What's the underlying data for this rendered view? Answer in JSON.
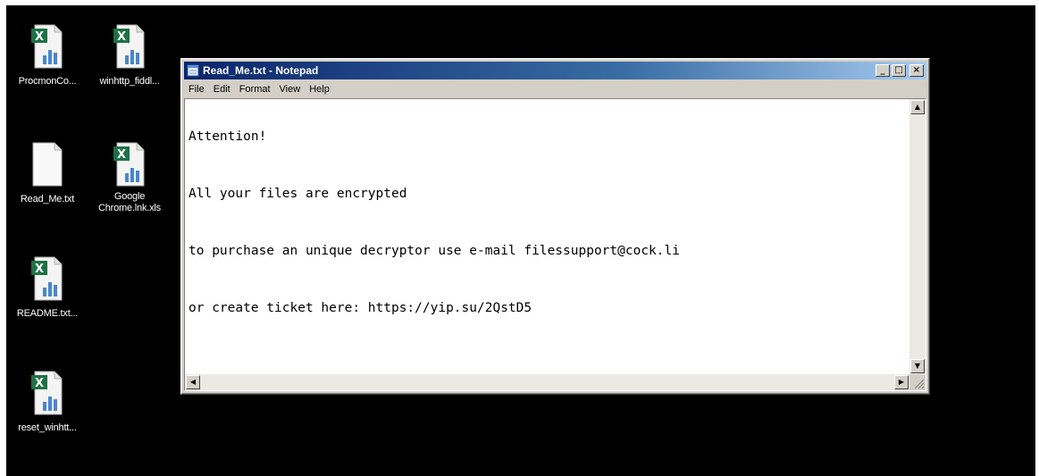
{
  "desktop": {
    "icons": [
      {
        "label": "ProcmonCo...",
        "type": "excel-file"
      },
      {
        "label": "winhttp_fiddl...",
        "type": "excel-file"
      },
      {
        "label": "Read_Me.txt",
        "type": "text-file"
      },
      {
        "label": "Google Chrome.lnk.xls",
        "type": "excel-file"
      },
      {
        "label": "README.txt...",
        "type": "excel-file"
      },
      {
        "label": "reset_winhtt...",
        "type": "excel-file"
      }
    ]
  },
  "notepad": {
    "title": "Read_Me.txt - Notepad",
    "buttons": {
      "minimize": "_",
      "maximize": "□",
      "close": "×"
    },
    "menu": [
      "File",
      "Edit",
      "Format",
      "View",
      "Help"
    ],
    "lines": [
      "Attention!",
      "All your files are encrypted",
      "to purchase an unique decryptor use e-mail filessupport@cock.li",
      "or create ticket here: https://yip.su/2QstD5"
    ],
    "scroll_arrows": {
      "up": "▲",
      "down": "▼",
      "left": "◀",
      "right": "▶"
    }
  },
  "colors": {
    "desktop": "#000000",
    "titlebar_start": "#0a246a",
    "titlebar_end": "#a6caf0",
    "window_face": "#d4d0c8",
    "excel_green": "#1e7145"
  }
}
